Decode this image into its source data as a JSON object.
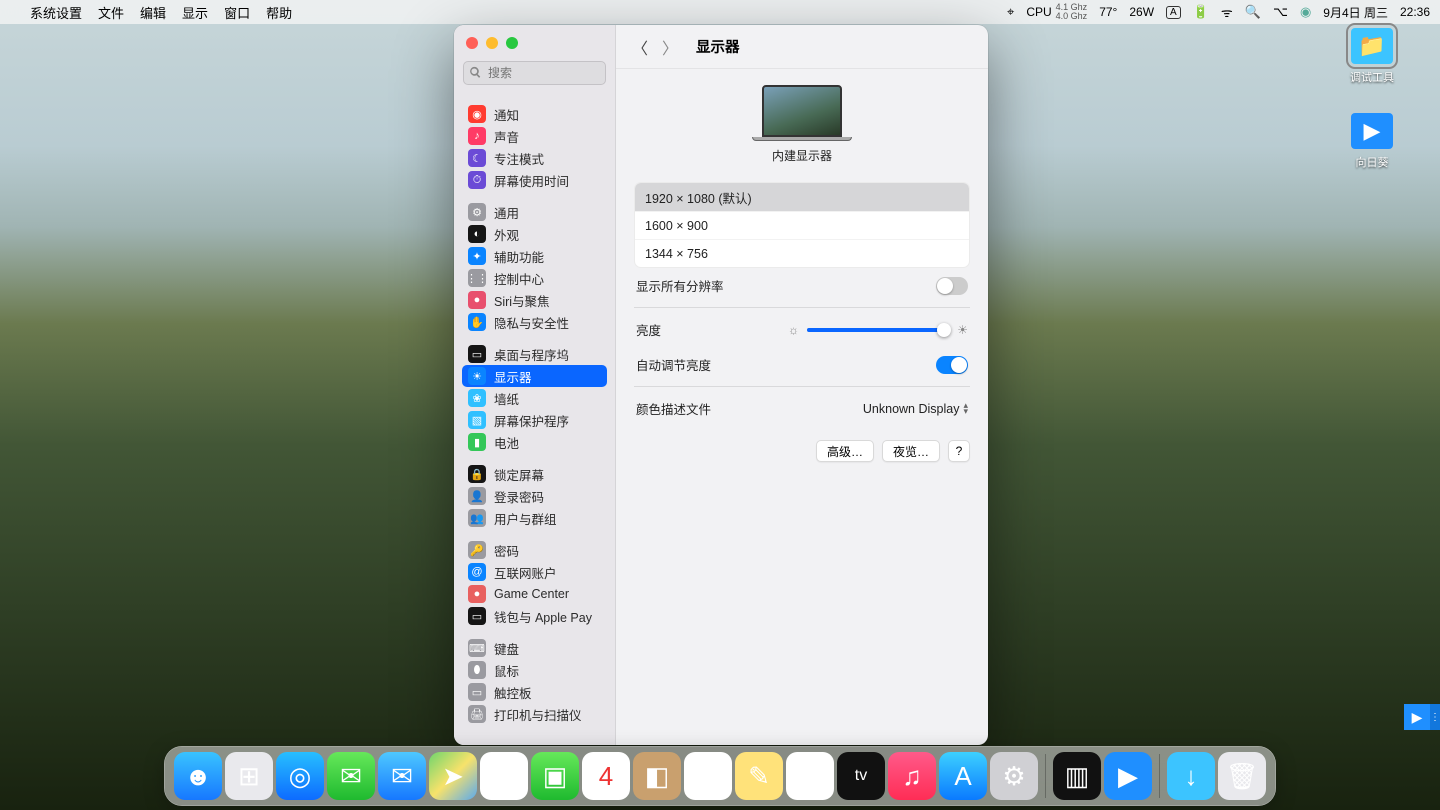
{
  "menubar": {
    "app": "系统设置",
    "items": [
      "文件",
      "编辑",
      "显示",
      "窗口",
      "帮助"
    ],
    "cpu_label": "CPU",
    "cpu_ghz1": "4.1 Ghz",
    "cpu_ghz2": "4.0 Ghz",
    "temp": "77°",
    "watt": "26W",
    "input": "A",
    "date": "9月4日 周三",
    "time": "22:36"
  },
  "window": {
    "title": "显示器",
    "search_placeholder": "搜索"
  },
  "sidebar": {
    "groups": [
      [
        {
          "label": "通知",
          "color": "#ff3b30",
          "glyph": "◉"
        },
        {
          "label": "声音",
          "color": "#ff3b66",
          "glyph": "♪"
        },
        {
          "label": "专注模式",
          "color": "#6b4bd6",
          "glyph": "☾"
        },
        {
          "label": "屏幕使用时间",
          "color": "#6b4bd6",
          "glyph": "⏱"
        }
      ],
      [
        {
          "label": "通用",
          "color": "#9a9aa0",
          "glyph": "⚙"
        },
        {
          "label": "外观",
          "color": "#151515",
          "glyph": "◐"
        },
        {
          "label": "辅助功能",
          "color": "#0a84ff",
          "glyph": "✦"
        },
        {
          "label": "控制中心",
          "color": "#9a9aa0",
          "glyph": "⋮⋮"
        },
        {
          "label": "Siri与聚焦",
          "color": "#e84f6d",
          "glyph": "●"
        },
        {
          "label": "隐私与安全性",
          "color": "#0a84ff",
          "glyph": "✋"
        }
      ],
      [
        {
          "label": "桌面与程序坞",
          "color": "#151515",
          "glyph": "▭"
        },
        {
          "label": "显示器",
          "color": "#0a84ff",
          "glyph": "☀",
          "selected": true
        },
        {
          "label": "墙纸",
          "color": "#30c0ff",
          "glyph": "❀"
        },
        {
          "label": "屏幕保护程序",
          "color": "#30c0ff",
          "glyph": "▧"
        },
        {
          "label": "电池",
          "color": "#34c759",
          "glyph": "▮"
        }
      ],
      [
        {
          "label": "锁定屏幕",
          "color": "#151515",
          "glyph": "🔒"
        },
        {
          "label": "登录密码",
          "color": "#9a9aa0",
          "glyph": "👤"
        },
        {
          "label": "用户与群组",
          "color": "#9a9aa0",
          "glyph": "👥"
        }
      ],
      [
        {
          "label": "密码",
          "color": "#9a9aa0",
          "glyph": "🔑"
        },
        {
          "label": "互联网账户",
          "color": "#0a84ff",
          "glyph": "@"
        },
        {
          "label": "Game Center",
          "color": "#e8605f",
          "glyph": "●"
        },
        {
          "label": "钱包与 Apple Pay",
          "color": "#151515",
          "glyph": "▭"
        }
      ],
      [
        {
          "label": "键盘",
          "color": "#9a9aa0",
          "glyph": "⌨"
        },
        {
          "label": "鼠标",
          "color": "#9a9aa0",
          "glyph": "⬮"
        },
        {
          "label": "触控板",
          "color": "#9a9aa0",
          "glyph": "▭"
        },
        {
          "label": "打印机与扫描仪",
          "color": "#9a9aa0",
          "glyph": "🖨"
        }
      ]
    ]
  },
  "display": {
    "name": "内建显示器",
    "resolutions": [
      {
        "label": "1920 × 1080 (默认)",
        "selected": true
      },
      {
        "label": "1600 × 900"
      },
      {
        "label": "1344 × 756"
      }
    ],
    "show_all_label": "显示所有分辨率",
    "show_all": false,
    "brightness_label": "亮度",
    "brightness_pct": 96,
    "auto_brightness_label": "自动调节亮度",
    "auto_brightness": true,
    "color_profile_label": "颜色描述文件",
    "color_profile_value": "Unknown Display",
    "btn_advanced": "高级…",
    "btn_night": "夜览…",
    "btn_help": "?"
  },
  "desktop": {
    "icons": [
      {
        "label": "调试工具",
        "selected": true,
        "color": "#3cc4ff"
      },
      {
        "label": "向日葵",
        "selected": false,
        "color": "#1f8fff"
      }
    ]
  },
  "dock": {
    "apps": [
      {
        "name": "finder",
        "bg": "linear-gradient(180deg,#39c3ff,#1778ff)",
        "glyph": "☻"
      },
      {
        "name": "launchpad",
        "bg": "#e9e9ed",
        "glyph": "⊞"
      },
      {
        "name": "safari",
        "bg": "linear-gradient(180deg,#27bfff,#0d6bff)",
        "glyph": "◎"
      },
      {
        "name": "messages",
        "bg": "linear-gradient(180deg,#66e85a,#1fba2f)",
        "glyph": "✉"
      },
      {
        "name": "mail",
        "bg": "linear-gradient(180deg,#4ec8ff,#1678ff)",
        "glyph": "✉"
      },
      {
        "name": "maps",
        "bg": "linear-gradient(135deg,#6fd56d,#f7e26b,#5aa9ee)",
        "glyph": "➤"
      },
      {
        "name": "photos",
        "bg": "#fff",
        "glyph": "✿"
      },
      {
        "name": "facetime",
        "bg": "linear-gradient(180deg,#66e85a,#1fba2f)",
        "glyph": "▣"
      },
      {
        "name": "calendar",
        "bg": "#fff",
        "glyph": "4",
        "text": "#e33"
      },
      {
        "name": "contacts",
        "bg": "#c9a06e",
        "glyph": "◧"
      },
      {
        "name": "reminders",
        "bg": "#fff",
        "glyph": "☰"
      },
      {
        "name": "notes",
        "bg": "#ffe27a",
        "glyph": "✎"
      },
      {
        "name": "freeform",
        "bg": "#fff",
        "glyph": "〰"
      },
      {
        "name": "tv",
        "bg": "#111",
        "glyph": "tv",
        "fs": "16"
      },
      {
        "name": "music",
        "bg": "linear-gradient(180deg,#ff5a8a,#ff2d55)",
        "glyph": "♫"
      },
      {
        "name": "appstore",
        "bg": "linear-gradient(180deg,#3dd0ff,#0a7aff)",
        "glyph": "A"
      },
      {
        "name": "settings",
        "bg": "#d0d0d4",
        "glyph": "⚙"
      }
    ],
    "apps2": [
      {
        "name": "mission",
        "bg": "#111",
        "glyph": "▥",
        "text": "#fff"
      },
      {
        "name": "sunlogin",
        "bg": "#1f8fff",
        "glyph": "▶"
      }
    ],
    "apps3": [
      {
        "name": "downloads",
        "bg": "#3cc4ff",
        "glyph": "↓"
      },
      {
        "name": "trash",
        "bg": "#e9e9ed",
        "glyph": "🗑"
      }
    ]
  }
}
